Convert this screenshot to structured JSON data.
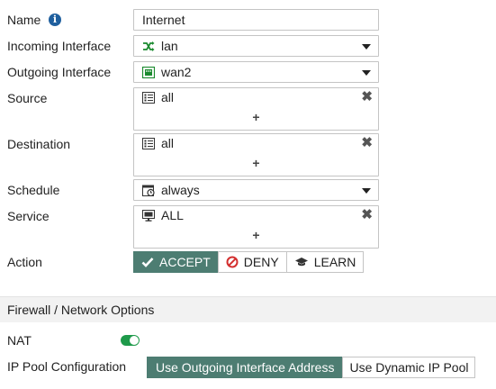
{
  "form": {
    "name": {
      "label": "Name",
      "value": "Internet",
      "info_icon": "info-icon"
    },
    "incoming_interface": {
      "label": "Incoming Interface",
      "value": "lan",
      "icon": "shuffle-icon"
    },
    "outgoing_interface": {
      "label": "Outgoing Interface",
      "value": "wan2",
      "icon": "port-icon"
    },
    "source": {
      "label": "Source",
      "value": "all",
      "icon": "address-list-icon",
      "add": "+",
      "remove": "✖"
    },
    "destination": {
      "label": "Destination",
      "value": "all",
      "icon": "address-list-icon",
      "add": "+",
      "remove": "✖"
    },
    "schedule": {
      "label": "Schedule",
      "value": "always",
      "icon": "schedule-clock-icon"
    },
    "service": {
      "label": "Service",
      "value": "ALL",
      "icon": "service-monitor-icon",
      "add": "+",
      "remove": "✖"
    },
    "action": {
      "label": "Action",
      "options": [
        {
          "label": "ACCEPT",
          "icon": "check-icon",
          "active": true
        },
        {
          "label": "DENY",
          "icon": "deny-icon",
          "active": false
        },
        {
          "label": "LEARN",
          "icon": "mortarboard-icon",
          "active": false
        }
      ]
    }
  },
  "firewall_section": {
    "title": "Firewall / Network Options",
    "nat": {
      "label": "NAT",
      "enabled": true
    },
    "ip_pool": {
      "label": "IP Pool Configuration",
      "options": [
        {
          "label": "Use Outgoing Interface Address",
          "active": true
        },
        {
          "label": "Use Dynamic IP Pool",
          "active": false
        }
      ]
    }
  },
  "colors": {
    "accent": "#4d7d72",
    "toggle_on": "#1e9a4a",
    "info": "#1f5f9e",
    "interface_green": "#1a8a2e"
  }
}
